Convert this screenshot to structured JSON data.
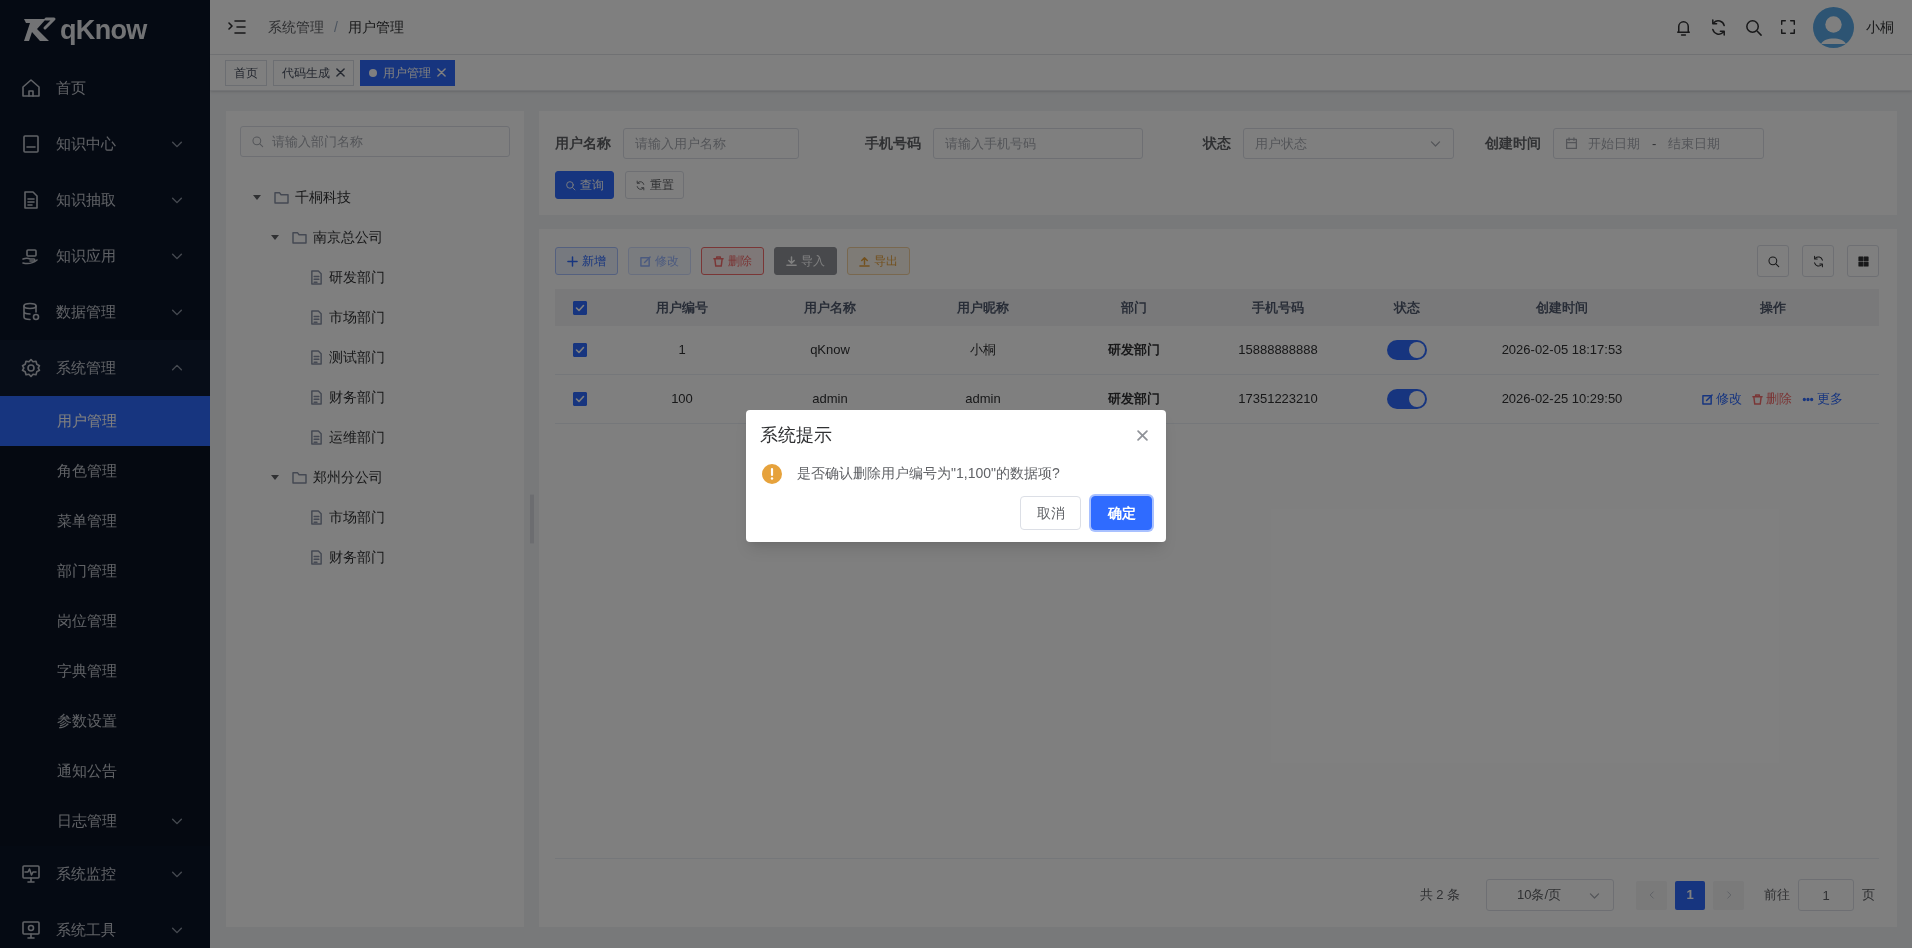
{
  "logo": {
    "text": "qKnow"
  },
  "sidebar": {
    "items": [
      {
        "label": "首页",
        "kind": "link",
        "selected": false
      },
      {
        "label": "知识中心",
        "kind": "group",
        "expanded": false,
        "selected": false
      },
      {
        "label": "知识抽取",
        "kind": "group",
        "expanded": false,
        "selected": false
      },
      {
        "label": "知识应用",
        "kind": "group",
        "expanded": false,
        "selected": false
      },
      {
        "label": "数据管理",
        "kind": "group",
        "expanded": false,
        "selected": false
      },
      {
        "label": "系统管理",
        "kind": "group",
        "expanded": true,
        "selected": false,
        "children": [
          {
            "label": "用户管理",
            "kind": "link",
            "selected": true
          },
          {
            "label": "角色管理",
            "kind": "link",
            "selected": false
          },
          {
            "label": "菜单管理",
            "kind": "link",
            "selected": false
          },
          {
            "label": "部门管理",
            "kind": "link",
            "selected": false
          },
          {
            "label": "岗位管理",
            "kind": "link",
            "selected": false
          },
          {
            "label": "字典管理",
            "kind": "link",
            "selected": false
          },
          {
            "label": "参数设置",
            "kind": "link",
            "selected": false
          },
          {
            "label": "通知公告",
            "kind": "link",
            "selected": false
          },
          {
            "label": "日志管理",
            "kind": "group",
            "expanded": false,
            "selected": false
          }
        ]
      },
      {
        "label": "系统监控",
        "kind": "group",
        "expanded": false,
        "selected": false
      },
      {
        "label": "系统工具",
        "kind": "group",
        "expanded": false,
        "selected": false
      }
    ]
  },
  "header": {
    "breadcrumb": [
      "系统管理",
      "用户管理"
    ],
    "breadcrumb_separator": "/",
    "user_name": "小桐"
  },
  "tabs": [
    {
      "label": "首页",
      "selected": false,
      "closable": false
    },
    {
      "label": "代码生成",
      "selected": false,
      "closable": true
    },
    {
      "label": "用户管理",
      "selected": true,
      "closable": true
    }
  ],
  "tree": {
    "search_placeholder": "请输入部门名称",
    "nodes": [
      {
        "label": "千桐科技",
        "expanded": true,
        "children": [
          {
            "label": "南京总公司",
            "expanded": true,
            "children": [
              {
                "label": "研发部门"
              },
              {
                "label": "市场部门"
              },
              {
                "label": "测试部门"
              },
              {
                "label": "财务部门"
              },
              {
                "label": "运维部门"
              }
            ]
          },
          {
            "label": "郑州分公司",
            "expanded": true,
            "children": [
              {
                "label": "市场部门"
              },
              {
                "label": "财务部门"
              }
            ]
          }
        ]
      }
    ]
  },
  "filters": [
    {
      "label": "用户名称",
      "kind": "text",
      "placeholder": "请输入用户名称"
    },
    {
      "label": "手机号码",
      "kind": "text",
      "placeholder": "请输入手机号码"
    },
    {
      "label": "状态",
      "kind": "select",
      "placeholder": "用户状态"
    },
    {
      "label": "创建时间",
      "kind": "daterange",
      "start_placeholder": "开始日期",
      "separator": "-",
      "end_placeholder": "结束日期"
    }
  ],
  "filter_buttons": [
    {
      "label": "查询",
      "kind": "primary"
    },
    {
      "label": "重置",
      "kind": "default"
    }
  ],
  "toolbar": [
    {
      "label": "新增",
      "kind": "primary",
      "disabled": false
    },
    {
      "label": "修改",
      "kind": "success",
      "disabled": true
    },
    {
      "label": "删除",
      "kind": "danger",
      "disabled": false
    },
    {
      "label": "导入",
      "kind": "info",
      "disabled": false
    },
    {
      "label": "导出",
      "kind": "warning",
      "disabled": false
    }
  ],
  "table": {
    "all_selected": true,
    "columns": [
      "用户编号",
      "用户名称",
      "用户昵称",
      "部门",
      "手机号码",
      "状态",
      "创建时间",
      "操作"
    ],
    "rows": [
      {
        "selected": true,
        "id": "1",
        "username": "qKnow",
        "nickname": "小桐",
        "dept": "研发部门",
        "phone": "15888888888",
        "enabled": true,
        "created": "2026-02-05 18:17:53"
      },
      {
        "selected": true,
        "id": "100",
        "username": "admin",
        "nickname": "admin",
        "dept": "研发部门",
        "phone": "17351223210",
        "enabled": true,
        "created": "2026-02-25 10:29:50",
        "actions": [
          {
            "label": "修改",
            "kind": "edit"
          },
          {
            "label": "删除",
            "kind": "delete"
          },
          {
            "label": "更多",
            "kind": "more"
          }
        ]
      }
    ]
  },
  "pagination": {
    "total": "共 2 条",
    "page_size": "10条/页",
    "pages": [
      {
        "label": "1",
        "selected": true
      }
    ],
    "goto_label": "前往",
    "goto_value": "1",
    "goto_suffix": "页"
  },
  "dialog": {
    "title": "系统提示",
    "message": "是否确认删除用户编号为\"1,100\"的数据项?",
    "buttons": [
      {
        "label": "取消",
        "kind": "default"
      },
      {
        "label": "确定",
        "kind": "primary"
      }
    ]
  }
}
